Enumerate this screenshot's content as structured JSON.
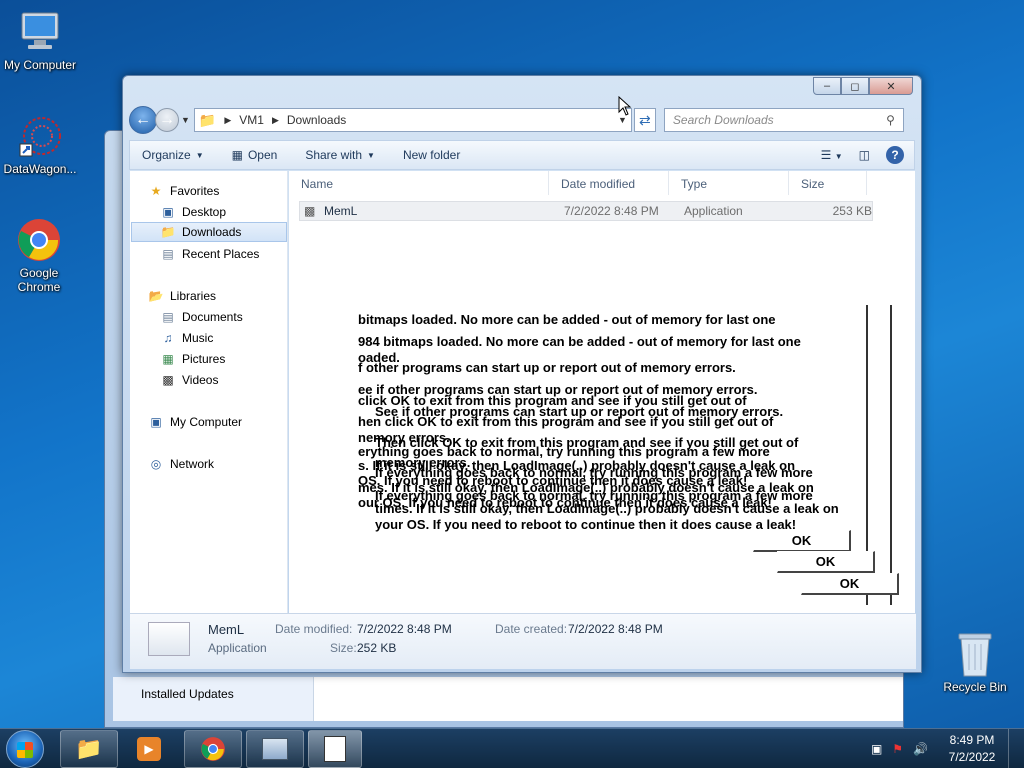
{
  "desktop": {
    "icons": [
      {
        "label": "My Computer"
      },
      {
        "label": "DataWagon..."
      },
      {
        "label": "Google Chrome"
      },
      {
        "label": "Recycle Bin"
      }
    ]
  },
  "background_window": {
    "item": "Installed Updates"
  },
  "explorer": {
    "breadcrumb": [
      "VM1",
      "Downloads"
    ],
    "search_placeholder": "Search Downloads",
    "toolbar": {
      "organize": "Organize",
      "open": "Open",
      "share": "Share with",
      "new_folder": "New folder"
    },
    "nav": {
      "favorites": "Favorites",
      "desktop": "Desktop",
      "downloads": "Downloads",
      "recent": "Recent Places",
      "libraries": "Libraries",
      "documents": "Documents",
      "music": "Music",
      "pictures": "Pictures",
      "videos": "Videos",
      "computer": "My Computer",
      "network": "Network"
    },
    "columns": {
      "name": "Name",
      "date": "Date modified",
      "type": "Type",
      "size": "Size"
    },
    "files": [
      {
        "name": "MemL",
        "date": "7/2/2022 8:48 PM",
        "type": "Application",
        "size": "253 KB"
      }
    ],
    "details": {
      "name": "MemL",
      "type": "Application",
      "date_modified_label": "Date modified:",
      "date_modified": "7/2/2022 8:48 PM",
      "date_created_label": "Date created:",
      "date_created": "7/2/2022 8:48 PM",
      "size_label": "Size:",
      "size": "252 KB"
    }
  },
  "message": {
    "lines": [
      " bitmaps loaded. No more can be added - out of memory for last one",
      "984 bitmaps loaded. No more can be added - out of memory for last one",
      "oaded.",
      "f other programs can start up or report out of memory errors.",
      "ee if other programs can start up or report out of memory errors.",
      " click OK to exit from this program and see if you still get out of",
      "See if other programs can start up or report out of memory errors.",
      "hen click OK to exit from this program and see if you still get out of",
      "nemory errors.",
      "Then click OK to exit from this program and see if you still get out of",
      "erything goes back to normal, try running this program a few more",
      "memory errors.",
      "s. If it is still okay, then LoadImage(..) probably doesn't cause a leak on",
      "If everything goes back to normal, try running this program a few more",
      "OS. If you need to reboot to continue then it does cause a leak!",
      "mes. If it is still okay, then LoadImage(..) probably doesn't cause a leak on",
      "If everything goes back to normal, try running this program a few more",
      "our OS. If you need to reboot to continue then it does cause a leak!",
      "times. If it is still okay, then LoadImage(..) probably doesn't cause a leak on",
      "your OS. If you need to reboot to continue then it does cause a leak!"
    ],
    "ok": "OK"
  },
  "taskbar": {
    "time": "8:49 PM",
    "date": "7/2/2022"
  }
}
